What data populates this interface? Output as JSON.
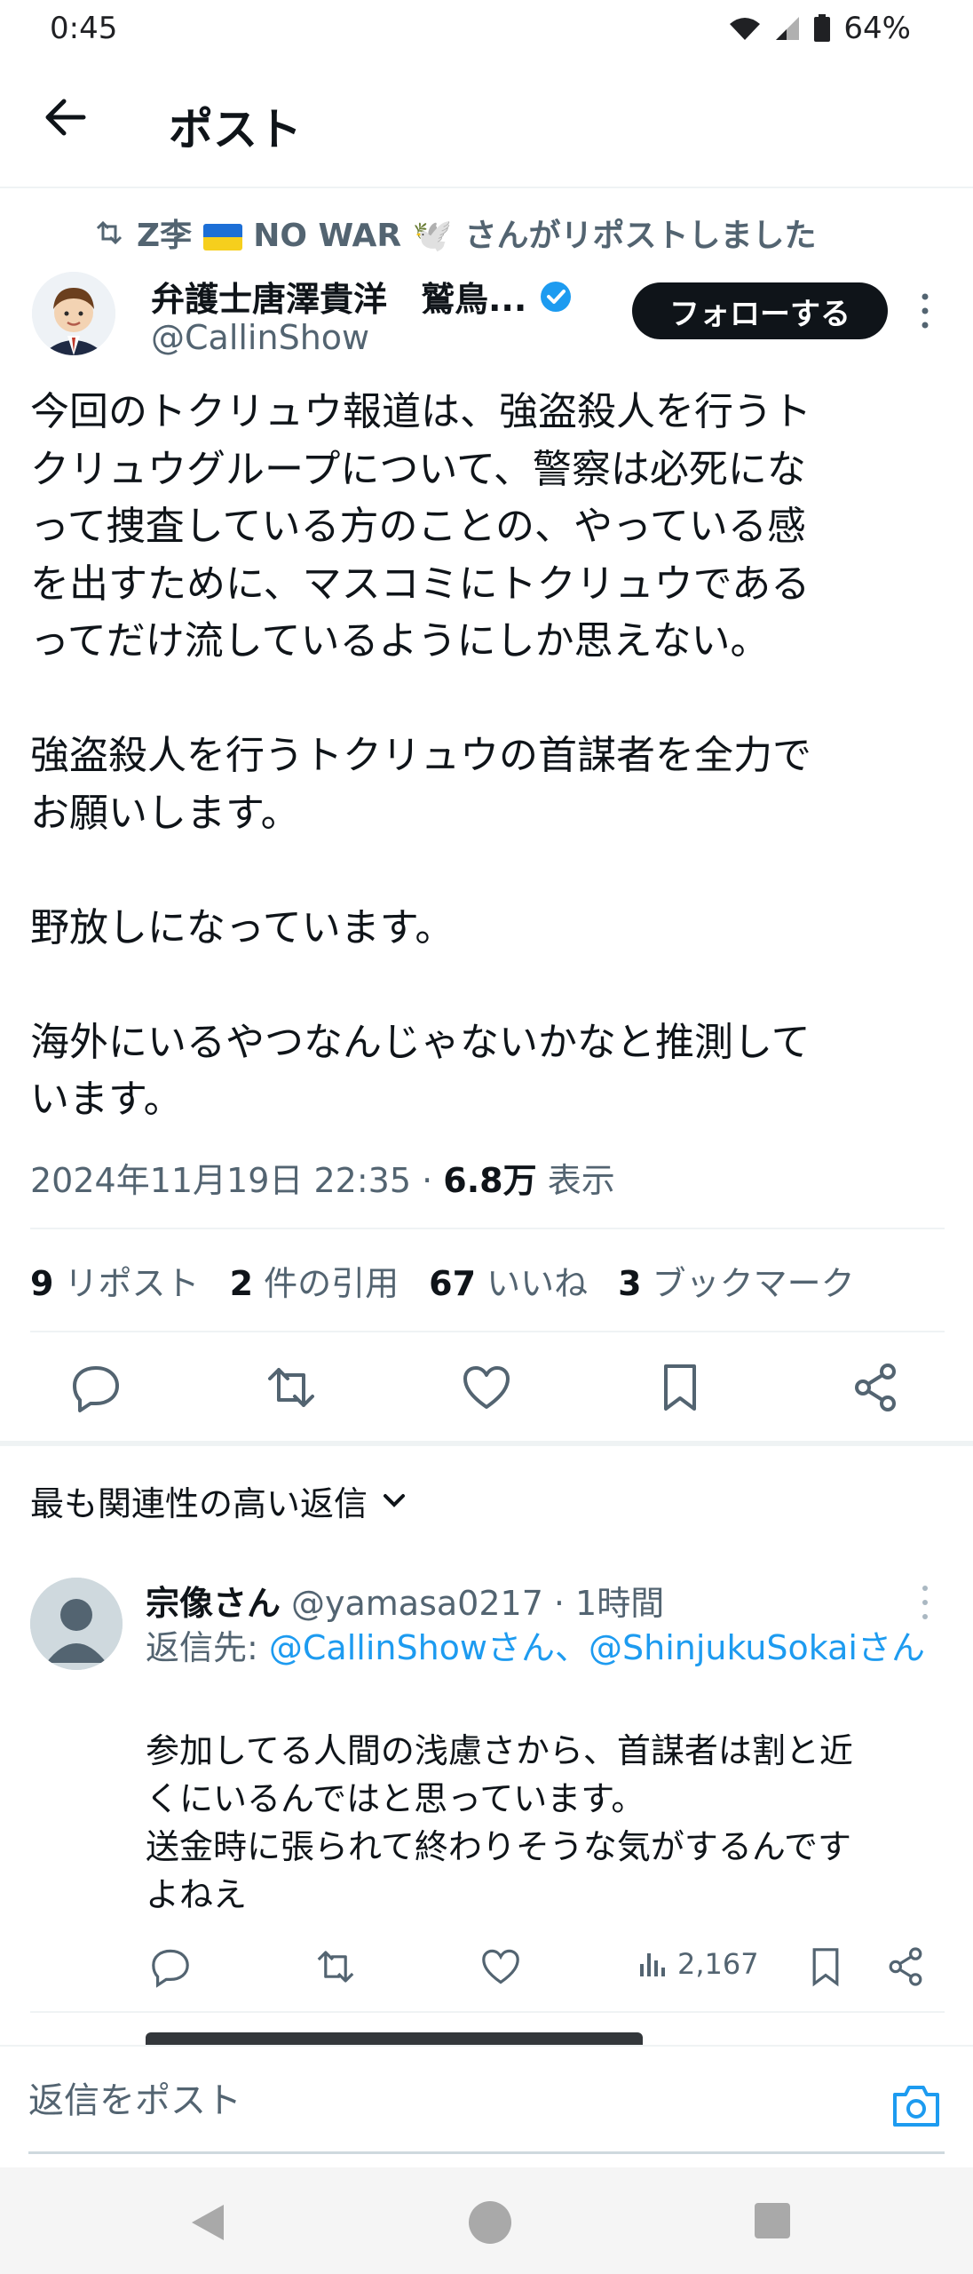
{
  "status_bar": {
    "time": "0:45",
    "battery": "64%"
  },
  "header": {
    "title": "ポスト"
  },
  "repost_label": {
    "name_prefix": "Z李",
    "name_suffix": "NO WAR 🕊️",
    "action": "さんがリポストしました"
  },
  "post": {
    "author_name": "弁護士唐澤貴洋　鷲鳥...",
    "author_handle": "@CallinShow",
    "follow_label": "フォローする",
    "text": "今回のトクリュウ報道は、強盗殺人を行うト\nクリュウグループについて、警察は必死にな\nって捜査している方のことの、やっている感\nを出すために、マスコミにトクリュウである\nってだけ流しているようにしか思えない。\n\n強盗殺人を行うトクリュウの首謀者を全力で\nお願いします。\n\n野放しになっています。\n\n海外にいるやつなんじゃないかなと推測して\nいます。",
    "timestamp": "2024年11月19日 22:35",
    "separator": "·",
    "views_count": "6.8万",
    "views_label": "表示",
    "stats": [
      {
        "count": "9",
        "label": "リポスト"
      },
      {
        "count": "2",
        "label": "件の引用"
      },
      {
        "count": "67",
        "label": "いいね"
      },
      {
        "count": "3",
        "label": "ブックマーク"
      }
    ]
  },
  "replies_section": {
    "sort_label": "最も関連性の高い返信"
  },
  "reply": {
    "name": "宗像さん",
    "handle": "@yamasa0217",
    "time": "· 1時間",
    "reply_to_prefix": "返信先: ",
    "reply_to_links": "@CallinShowさん、@ShinjukuSokaiさん",
    "text": "参加してる人間の浅慮さから、首謀者は割と近\nくにいるんではと思っています。\n送金時に張られて終わりそうな気がするんです\nよねえ",
    "views": "2,167"
  },
  "composer": {
    "placeholder": "返信をポスト"
  },
  "colors": {
    "accent": "#1d9bf0",
    "text": "#0f1419",
    "muted": "#536471",
    "divider": "#eff3f4"
  }
}
